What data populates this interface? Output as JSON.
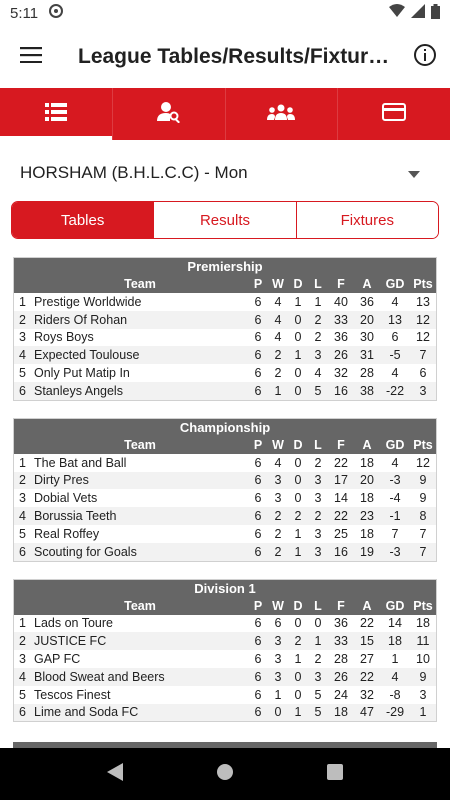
{
  "status_bar": {
    "time": "5:11"
  },
  "app_bar": {
    "title": "League Tables/Results/Fixtur…"
  },
  "tabs": [
    {
      "icon": "list-icon",
      "active": true
    },
    {
      "icon": "person-search-icon",
      "active": false
    },
    {
      "icon": "group-icon",
      "active": false
    },
    {
      "icon": "card-icon",
      "active": false
    }
  ],
  "league_select": {
    "value": "HORSHAM (B.H.L.C.C) - Mon"
  },
  "segments": {
    "tables": "Tables",
    "results": "Results",
    "fixtures": "Fixtures"
  },
  "columns": {
    "team": "Team",
    "p": "P",
    "w": "W",
    "d": "D",
    "l": "L",
    "f": "F",
    "a": "A",
    "gd": "GD",
    "pts": "Pts"
  },
  "divisions": [
    {
      "name": "Premiership",
      "rows": [
        {
          "pos": "1",
          "team": "Prestige Worldwide",
          "p": "6",
          "w": "4",
          "d": "1",
          "l": "1",
          "f": "40",
          "a": "36",
          "gd": "4",
          "pts": "13"
        },
        {
          "pos": "2",
          "team": "Riders Of Rohan",
          "p": "6",
          "w": "4",
          "d": "0",
          "l": "2",
          "f": "33",
          "a": "20",
          "gd": "13",
          "pts": "12"
        },
        {
          "pos": "3",
          "team": "Roys Boys",
          "p": "6",
          "w": "4",
          "d": "0",
          "l": "2",
          "f": "36",
          "a": "30",
          "gd": "6",
          "pts": "12"
        },
        {
          "pos": "4",
          "team": "Expected Toulouse",
          "p": "6",
          "w": "2",
          "d": "1",
          "l": "3",
          "f": "26",
          "a": "31",
          "gd": "-5",
          "pts": "7"
        },
        {
          "pos": "5",
          "team": "Only Put Matip In",
          "p": "6",
          "w": "2",
          "d": "0",
          "l": "4",
          "f": "32",
          "a": "28",
          "gd": "4",
          "pts": "6"
        },
        {
          "pos": "6",
          "team": "Stanleys Angels",
          "p": "6",
          "w": "1",
          "d": "0",
          "l": "5",
          "f": "16",
          "a": "38",
          "gd": "-22",
          "pts": "3"
        }
      ]
    },
    {
      "name": "Championship",
      "rows": [
        {
          "pos": "1",
          "team": "The Bat and Ball",
          "p": "6",
          "w": "4",
          "d": "0",
          "l": "2",
          "f": "22",
          "a": "18",
          "gd": "4",
          "pts": "12"
        },
        {
          "pos": "2",
          "team": "Dirty Pres",
          "p": "6",
          "w": "3",
          "d": "0",
          "l": "3",
          "f": "17",
          "a": "20",
          "gd": "-3",
          "pts": "9"
        },
        {
          "pos": "3",
          "team": "Dobial Vets",
          "p": "6",
          "w": "3",
          "d": "0",
          "l": "3",
          "f": "14",
          "a": "18",
          "gd": "-4",
          "pts": "9"
        },
        {
          "pos": "4",
          "team": "Borussia Teeth",
          "p": "6",
          "w": "2",
          "d": "2",
          "l": "2",
          "f": "22",
          "a": "23",
          "gd": "-1",
          "pts": "8"
        },
        {
          "pos": "5",
          "team": "Real Roffey",
          "p": "6",
          "w": "2",
          "d": "1",
          "l": "3",
          "f": "25",
          "a": "18",
          "gd": "7",
          "pts": "7"
        },
        {
          "pos": "6",
          "team": "Scouting for Goals",
          "p": "6",
          "w": "2",
          "d": "1",
          "l": "3",
          "f": "16",
          "a": "19",
          "gd": "-3",
          "pts": "7"
        }
      ]
    },
    {
      "name": "Division 1",
      "rows": [
        {
          "pos": "1",
          "team": "Lads on Toure",
          "p": "6",
          "w": "6",
          "d": "0",
          "l": "0",
          "f": "36",
          "a": "22",
          "gd": "14",
          "pts": "18"
        },
        {
          "pos": "2",
          "team": "JUSTICE FC",
          "p": "6",
          "w": "3",
          "d": "2",
          "l": "1",
          "f": "33",
          "a": "15",
          "gd": "18",
          "pts": "11"
        },
        {
          "pos": "3",
          "team": "GAP FC",
          "p": "6",
          "w": "3",
          "d": "1",
          "l": "2",
          "f": "28",
          "a": "27",
          "gd": "1",
          "pts": "10"
        },
        {
          "pos": "4",
          "team": "Blood Sweat and Beers",
          "p": "6",
          "w": "3",
          "d": "0",
          "l": "3",
          "f": "26",
          "a": "22",
          "gd": "4",
          "pts": "9"
        },
        {
          "pos": "5",
          "team": "Tescos Finest",
          "p": "6",
          "w": "1",
          "d": "0",
          "l": "5",
          "f": "24",
          "a": "32",
          "gd": "-8",
          "pts": "3"
        },
        {
          "pos": "6",
          "team": "Lime and Soda FC",
          "p": "6",
          "w": "0",
          "d": "1",
          "l": "5",
          "f": "18",
          "a": "47",
          "gd": "-29",
          "pts": "1"
        }
      ]
    }
  ],
  "colors": {
    "accent": "#d71920",
    "header_bg": "#666666",
    "stripe": "#f2f2f2"
  }
}
